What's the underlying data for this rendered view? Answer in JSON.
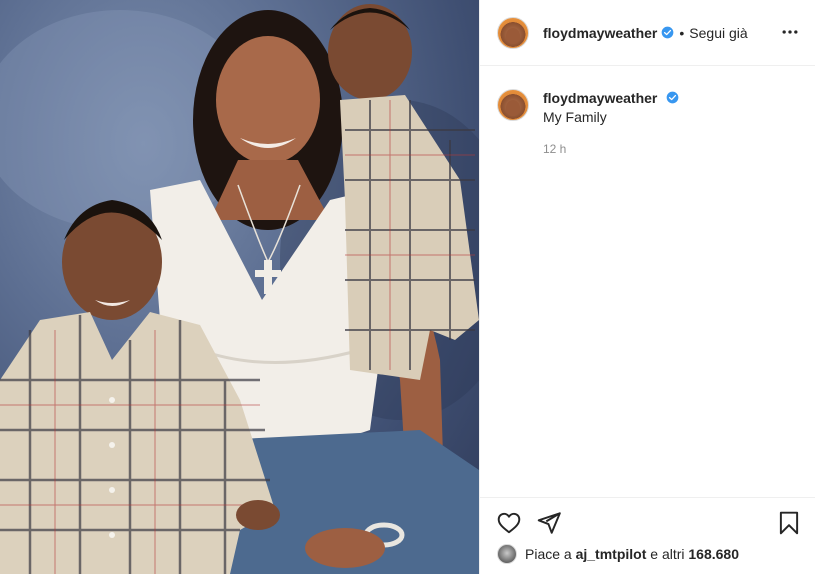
{
  "header": {
    "username": "floydmayweather",
    "separator": "•",
    "follow_state": "Segui già",
    "icons": {
      "avatar": "profile-avatar",
      "verified": "verified-badge-icon",
      "more": "more-options-icon"
    }
  },
  "caption": {
    "username": "floydmayweather",
    "text": "My Family",
    "time": "12 h"
  },
  "actions": {
    "icons": [
      "heart-icon",
      "share-icon",
      "save-icon"
    ]
  },
  "likes": {
    "prefix": "Piace a",
    "first_user": "aj_tmtpilot",
    "conjunction": "e altri",
    "count": "168.680"
  },
  "colors": {
    "verified": "#3897f0",
    "text": "#262626",
    "muted": "#8e8e8e",
    "border": "#efefef"
  }
}
